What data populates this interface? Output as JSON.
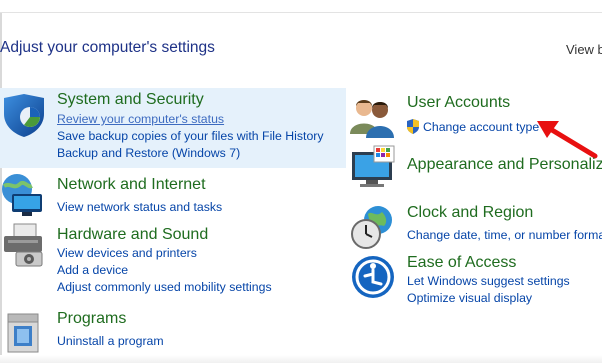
{
  "page": {
    "title": "Adjust your computer's settings",
    "view_by": "View by"
  },
  "left": [
    {
      "title": "System and Security",
      "icon": "shield-icon",
      "links": [
        "Review your computer's status",
        "Save backup copies of your files with File History",
        "Backup and Restore (Windows 7)"
      ]
    },
    {
      "title": "Network and Internet",
      "icon": "network-icon",
      "links": [
        "View network status and tasks"
      ]
    },
    {
      "title": "Hardware and Sound",
      "icon": "printer-icon",
      "links": [
        "View devices and printers",
        "Add a device",
        "Adjust commonly used mobility settings"
      ]
    },
    {
      "title": "Programs",
      "icon": "programs-icon",
      "links": [
        "Uninstall a program"
      ]
    }
  ],
  "right": [
    {
      "title": "User Accounts",
      "icon": "users-icon",
      "links": [
        "Change account type"
      ]
    },
    {
      "title": "Appearance and Personaliza",
      "icon": "monitor-icon",
      "links": []
    },
    {
      "title": "Clock and Region",
      "icon": "clock-globe-icon",
      "links": [
        "Change date, time, or number forma"
      ]
    },
    {
      "title": "Ease of Access",
      "icon": "ease-of-access-icon",
      "links": [
        "Let Windows suggest settings",
        "Optimize visual display"
      ]
    }
  ],
  "colors": {
    "category_title": "#1f6c1f",
    "link": "#0645a8",
    "page_title": "#1e3287",
    "highlight": "#e5f1fb",
    "arrow": "#e81010"
  }
}
